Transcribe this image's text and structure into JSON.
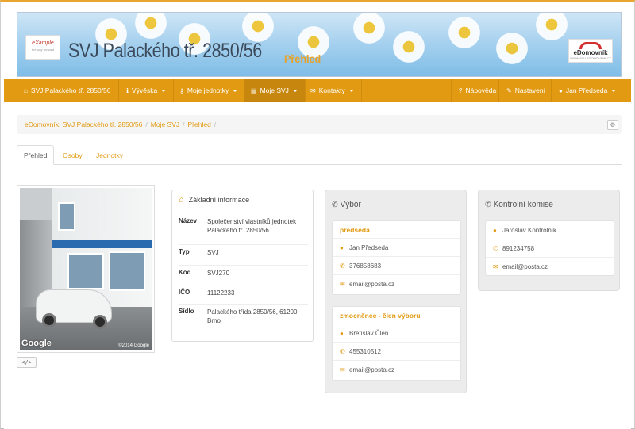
{
  "banner": {
    "title": "SVJ Palackého tř. 2850/56",
    "subtitle": "Přehled",
    "logo_left": "eXample",
    "logo_left_tagline": "the way forward",
    "logo_right": "eDomovník",
    "logo_right_tagline": "WWW.SVJ.EDOMOVNIK.CZ"
  },
  "navbar": {
    "items": [
      {
        "label": "SVJ Palackého tř. 2850/56",
        "icon": "home-icon"
      },
      {
        "label": "Vývěska",
        "icon": "info-icon"
      },
      {
        "label": "Moje jednotky",
        "icon": "key-icon"
      },
      {
        "label": "Moje SVJ",
        "icon": "building-icon"
      },
      {
        "label": "Kontakty",
        "icon": "envelope-icon"
      }
    ],
    "right": [
      {
        "label": "Nápověda",
        "icon": "question-icon"
      },
      {
        "label": "Nastavení",
        "icon": "wrench-icon"
      },
      {
        "label": "Jan Předseda",
        "icon": "user-icon"
      }
    ]
  },
  "breadcrumb": [
    "eDomovník: SVJ Palackého tř. 2850/56",
    "Moje SVJ",
    "Přehled"
  ],
  "tabs": [
    "Přehled",
    "Osoby",
    "Jednotky"
  ],
  "photo": {
    "brand": "Google",
    "copyright": "©2014 Google"
  },
  "code_button": "</>",
  "info": {
    "title": "Základní informace",
    "rows": [
      {
        "key": "Název",
        "value": "Společenství vlastníků jednotek Palackého tř. 2850/56"
      },
      {
        "key": "Typ",
        "value": "SVJ"
      },
      {
        "key": "Kód",
        "value": "SVJ270"
      },
      {
        "key": "IČO",
        "value": "11122233"
      },
      {
        "key": "Sídlo",
        "value": "Palackého třída 2850/56, 61200 Brno"
      }
    ]
  },
  "vybor": {
    "title": "Výbor",
    "members": [
      {
        "role": "předseda",
        "name": "Jan Předseda",
        "phone": "376858683",
        "email": "email@posta.cz"
      },
      {
        "role": "zmocněnec - člen výboru",
        "name": "Břetislav Člen",
        "phone": "455310512",
        "email": "email@posta.cz"
      }
    ]
  },
  "komise": {
    "title": "Kontrolní komise",
    "members": [
      {
        "name": "Jaroslav Kontrolník",
        "phone": "891234758",
        "email": "email@posta.cz"
      }
    ]
  },
  "colors": {
    "accent": "#e19a11",
    "navbar": "#e19a11"
  }
}
